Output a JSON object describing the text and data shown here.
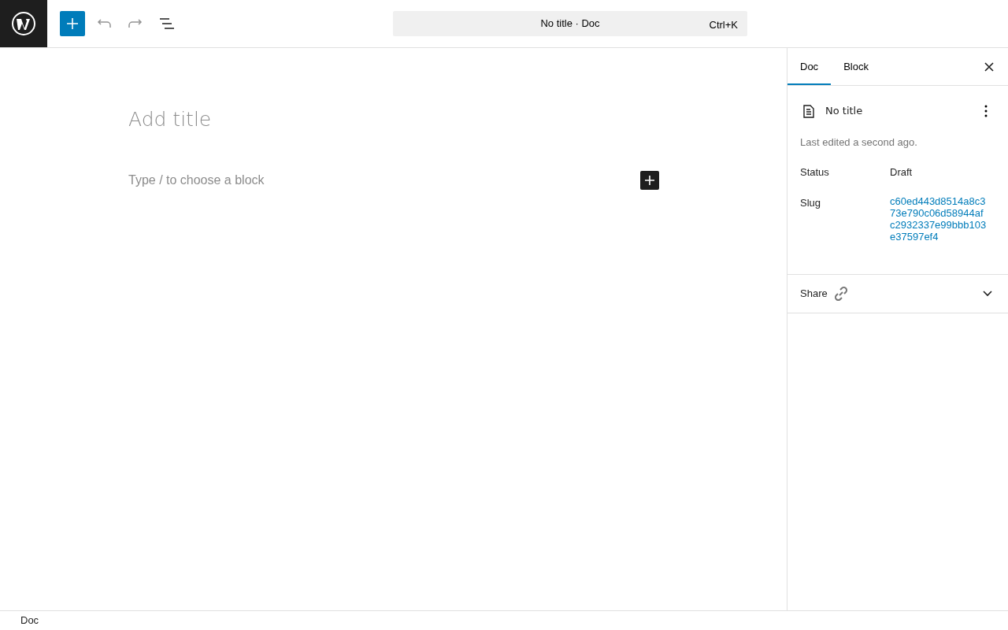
{
  "toolbar": {
    "undo": {
      "disabled": true
    },
    "redo": {
      "disabled": true
    }
  },
  "command_bar": {
    "title": "No title · Doc",
    "shortcut": "Ctrl+K"
  },
  "editor": {
    "title_placeholder": "Add title",
    "block_placeholder": "Type / to choose a block"
  },
  "sidebar": {
    "tabs": [
      {
        "label": "Doc",
        "selected": true
      },
      {
        "label": "Block",
        "selected": false
      }
    ],
    "document": {
      "title": "No title",
      "last_edited": "Last edited a second ago."
    },
    "fields": [
      {
        "kind": "text",
        "label": "Status",
        "value": "Draft"
      },
      {
        "kind": "link",
        "label": "Slug",
        "value": "c60ed443d8514a8c373e790c06d58944afc2932337e99bbb103e37597ef4"
      }
    ],
    "share": {
      "label": "Share",
      "expanded": false
    }
  },
  "status_bar": {
    "breadcrumb": "Doc"
  }
}
